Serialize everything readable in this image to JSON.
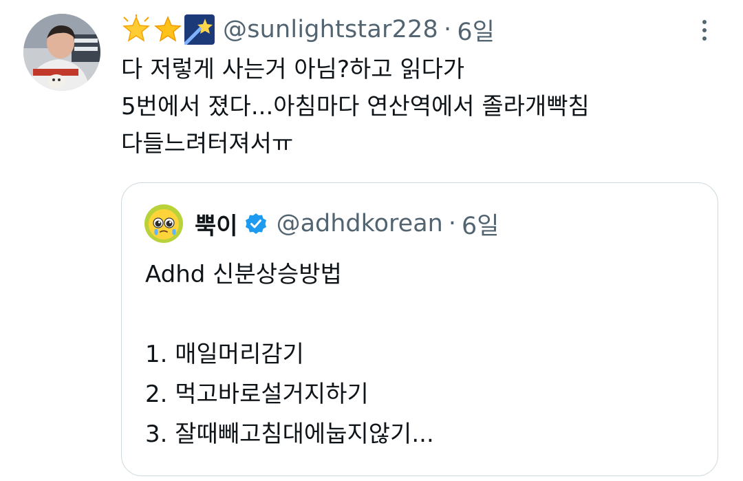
{
  "tweet": {
    "author_emojis": [
      "glowing-star",
      "star",
      "shooting-star"
    ],
    "handle": "@sunlightstar228",
    "separator": "·",
    "time": "6일",
    "text_lines": [
      "다 저렇게 사는거 아님?하고 읽다가",
      "5번에서 졌다...아침마다 연산역에서 졸라개빡침",
      "다들느려터져서ㅠ"
    ]
  },
  "quote": {
    "display_name": "뿍이",
    "verified": true,
    "handle": "@adhdkorean",
    "separator": "·",
    "time": "6일",
    "text_lines": [
      "Adhd 신분상승방법",
      "",
      "1. 매일머리감기",
      "2. 먹고바로설거지하기",
      "3. 잘때빼고침대에눕지않기..."
    ]
  },
  "icons": {
    "more": "more-vertical-icon",
    "verified": "verified-badge-icon"
  },
  "colors": {
    "text": "#0f1419",
    "secondary": "#536471",
    "border": "#cfd9de",
    "verified_blue": "#1d9bf0"
  }
}
